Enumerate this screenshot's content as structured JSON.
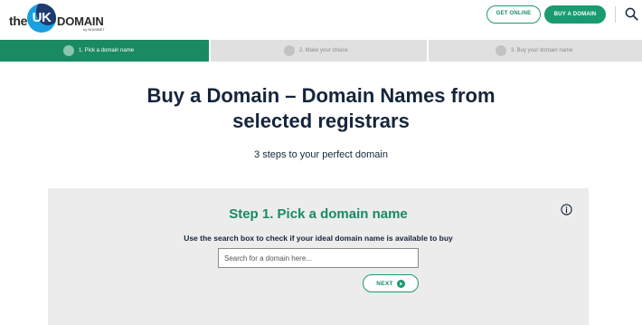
{
  "header": {
    "logo": {
      "the": "the",
      "uk": "UK",
      "domain": "DOMAIN",
      "by": "by NOMINET"
    },
    "get_online_label": "GET ONLINE",
    "buy_domain_label": "BUY A DOMAIN",
    "search_icon": "search-icon"
  },
  "steps": [
    {
      "label": "1. Pick a domain name",
      "state": "active"
    },
    {
      "label": "2. Make your choice",
      "state": "inactive"
    },
    {
      "label": "3. Buy your domain name",
      "state": "inactive"
    }
  ],
  "main": {
    "title_line1": "Buy a Domain – Domain Names from",
    "title_line2": "selected registrars",
    "subtitle": "3 steps to your perfect domain"
  },
  "panel": {
    "heading": "Step 1. Pick a domain name",
    "description": "Use the search box to check if your ideal domain name is available to buy",
    "search_placeholder": "Search for a domain here...",
    "search_value": "",
    "next_label": "NEXT",
    "next_icon": "arrow-right-circle-icon",
    "info_icon": "info-icon"
  },
  "colors": {
    "brand_green": "#1a8a62",
    "navy": "#15253b",
    "panel_bg": "#ececec",
    "logo_blue": "#1aa0e0"
  }
}
